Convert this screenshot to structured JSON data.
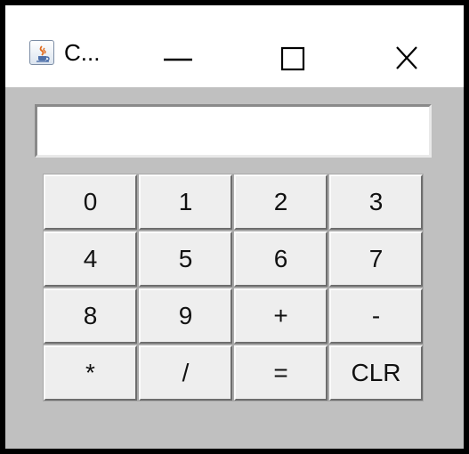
{
  "window": {
    "title": "C...",
    "icon": "java-cup-icon",
    "controls": {
      "minimize": "minimize-icon",
      "maximize": "maximize-icon",
      "close": "close-icon"
    }
  },
  "display": {
    "value": ""
  },
  "keypad": {
    "keys": [
      "0",
      "1",
      "2",
      "3",
      "4",
      "5",
      "6",
      "7",
      "8",
      "9",
      "+",
      "-",
      "*",
      "/",
      "=",
      "CLR"
    ]
  },
  "colors": {
    "frame": "#000000",
    "client_background": "#c0c0c0",
    "titlebar": "#ffffff",
    "button_face": "#eeeeee"
  }
}
